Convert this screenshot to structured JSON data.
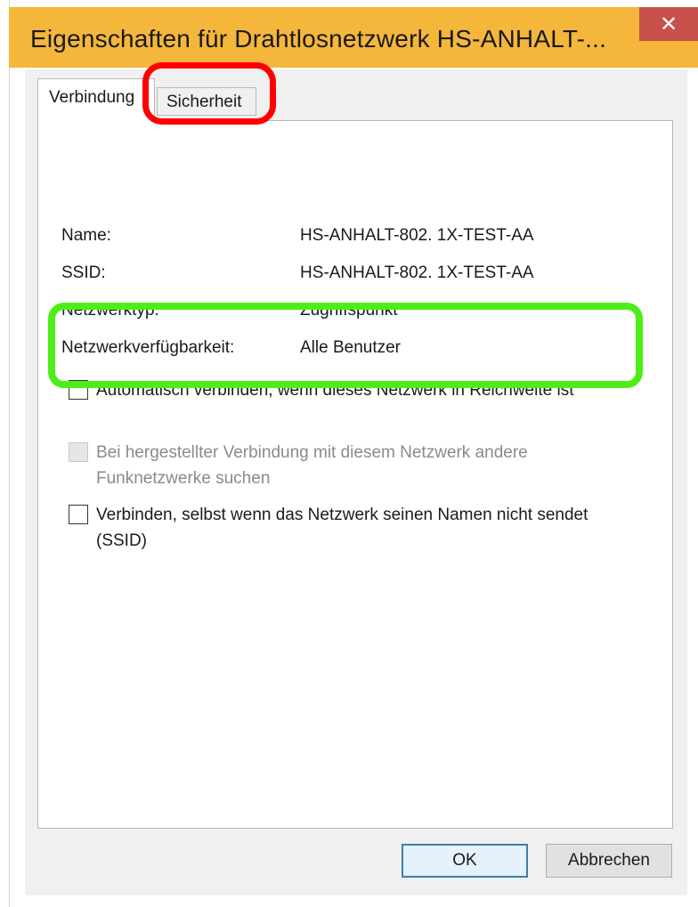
{
  "window": {
    "title": "Eigenschaften für Drahtlosnetzwerk HS-ANHALT-...",
    "close_glyph": "✕",
    "frame_color": "#f4b63b",
    "close_color": "#c7514a"
  },
  "tabs": [
    {
      "label": "Verbindung",
      "active": true
    },
    {
      "label": "Sicherheit",
      "active": false
    }
  ],
  "properties": [
    {
      "label": "Name:",
      "value": "HS-ANHALT-802. 1X-TEST-AA"
    },
    {
      "label": "SSID:",
      "value": "HS-ANHALT-802. 1X-TEST-AA"
    },
    {
      "label": "Netzwerktyp:",
      "value": "Zugriffspunkt"
    },
    {
      "label": "Netzwerkverfügbarkeit:",
      "value": "Alle Benutzer"
    }
  ],
  "options": [
    {
      "label": "Automatisch verbinden, wenn dieses Netzwerk in Reichweite ist",
      "checked": false,
      "enabled": true
    },
    {
      "label": "Bei hergestellter Verbindung mit diesem Netzwerk andere Funknetzwerke suchen",
      "checked": false,
      "enabled": false
    },
    {
      "label": "Verbinden, selbst wenn das Netzwerk seinen Namen nicht sendet (SSID)",
      "checked": false,
      "enabled": true
    }
  ],
  "buttons": {
    "ok": "OK",
    "cancel": "Abbrechen"
  },
  "annotations": {
    "red_color": "#ff0000",
    "green_color": "#4dee18"
  }
}
